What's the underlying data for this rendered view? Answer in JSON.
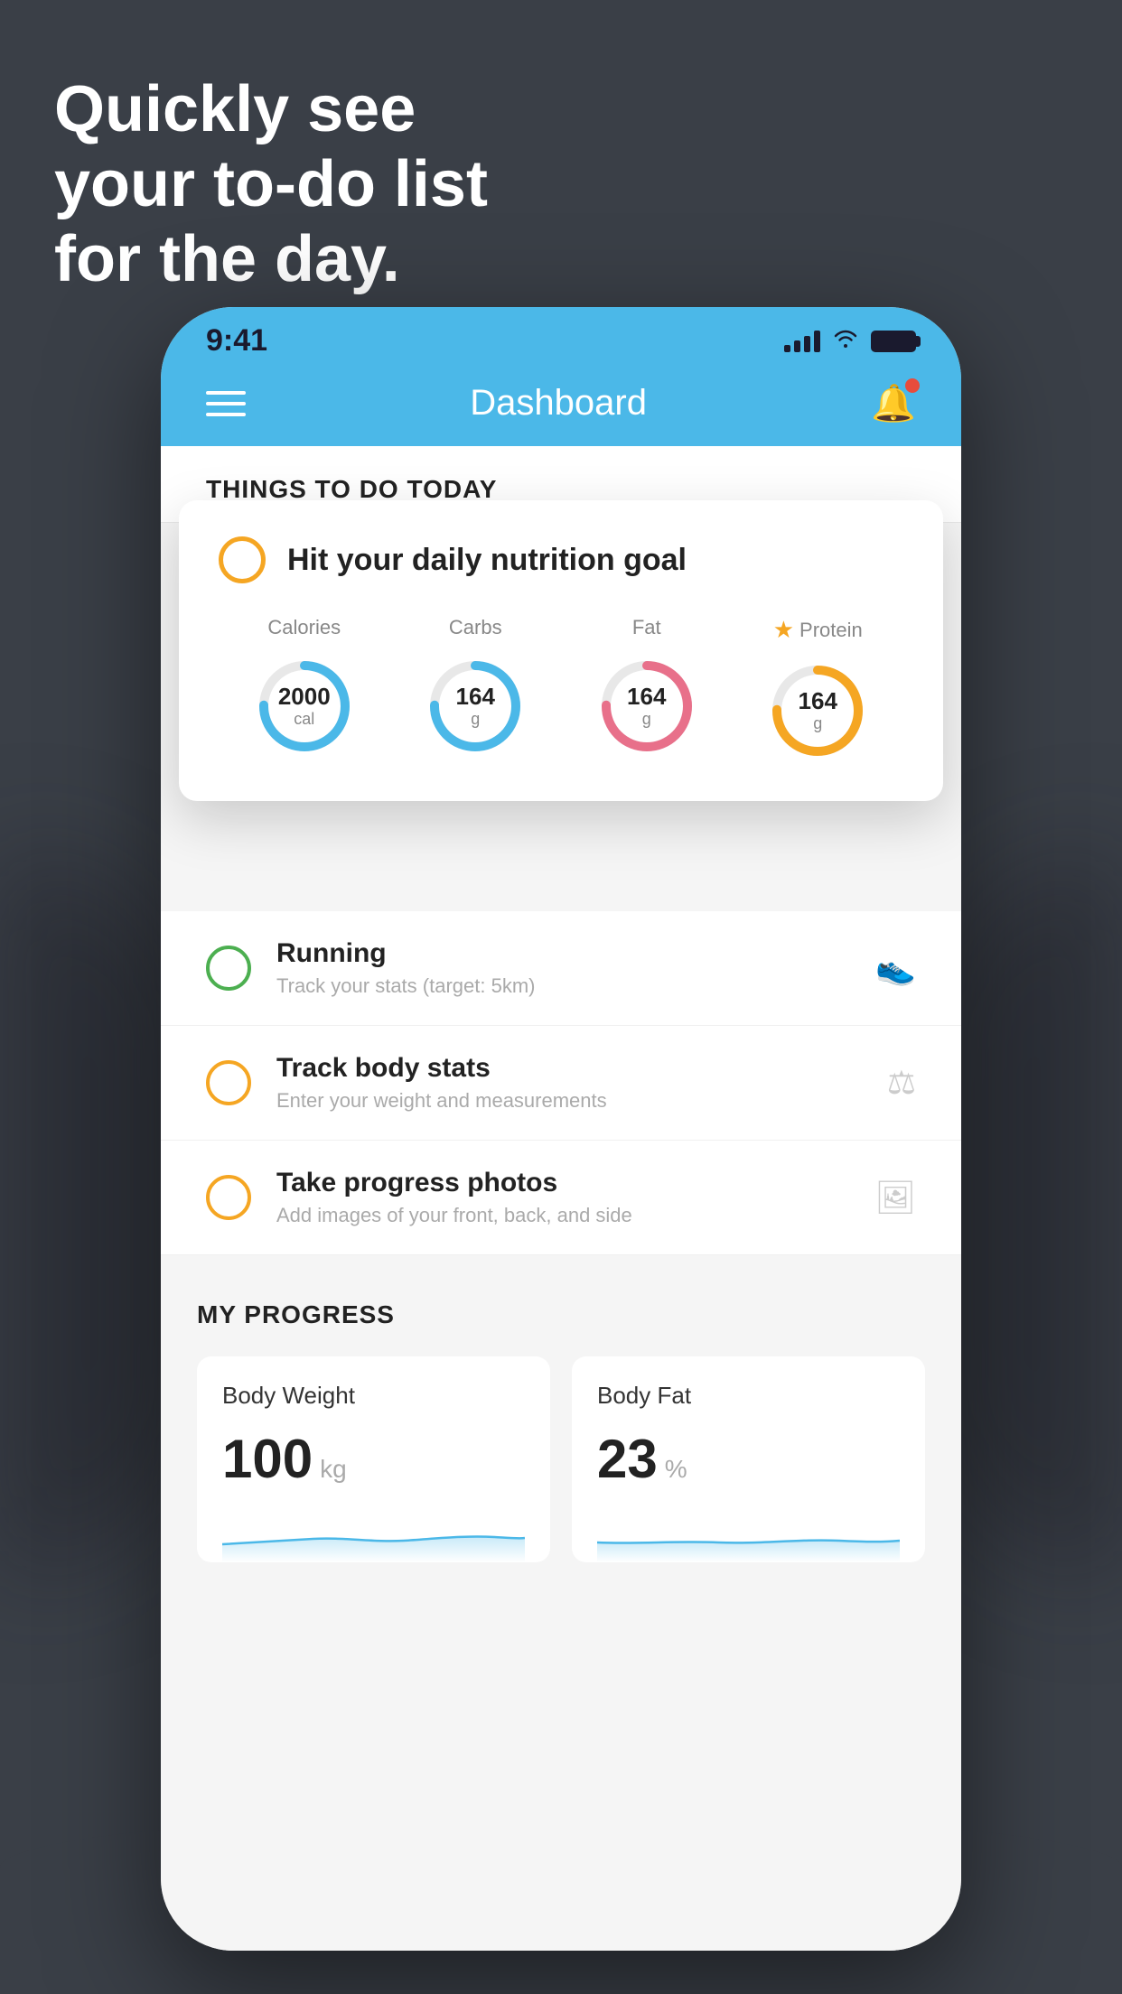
{
  "headline": {
    "line1": "Quickly see",
    "line2": "your to-do list",
    "line3": "for the day."
  },
  "status_bar": {
    "time": "9:41"
  },
  "nav": {
    "title": "Dashboard"
  },
  "things_section": {
    "title": "THINGS TO DO TODAY"
  },
  "nutrition_card": {
    "check_label": "Hit your daily nutrition goal",
    "columns": [
      {
        "label": "Calories",
        "value": "2000",
        "unit": "cal",
        "color": "blue",
        "star": false
      },
      {
        "label": "Carbs",
        "value": "164",
        "unit": "g",
        "color": "blue",
        "star": false
      },
      {
        "label": "Fat",
        "value": "164",
        "unit": "g",
        "color": "pink",
        "star": false
      },
      {
        "label": "Protein",
        "value": "164",
        "unit": "g",
        "color": "yellow",
        "star": true
      }
    ]
  },
  "todo_items": [
    {
      "title": "Running",
      "subtitle": "Track your stats (target: 5km)",
      "circle_color": "green"
    },
    {
      "title": "Track body stats",
      "subtitle": "Enter your weight and measurements",
      "circle_color": "yellow"
    },
    {
      "title": "Take progress photos",
      "subtitle": "Add images of your front, back, and side",
      "circle_color": "yellow"
    }
  ],
  "progress_section": {
    "title": "MY PROGRESS",
    "cards": [
      {
        "title": "Body Weight",
        "value": "100",
        "unit": "kg"
      },
      {
        "title": "Body Fat",
        "value": "23",
        "unit": "%"
      }
    ]
  }
}
